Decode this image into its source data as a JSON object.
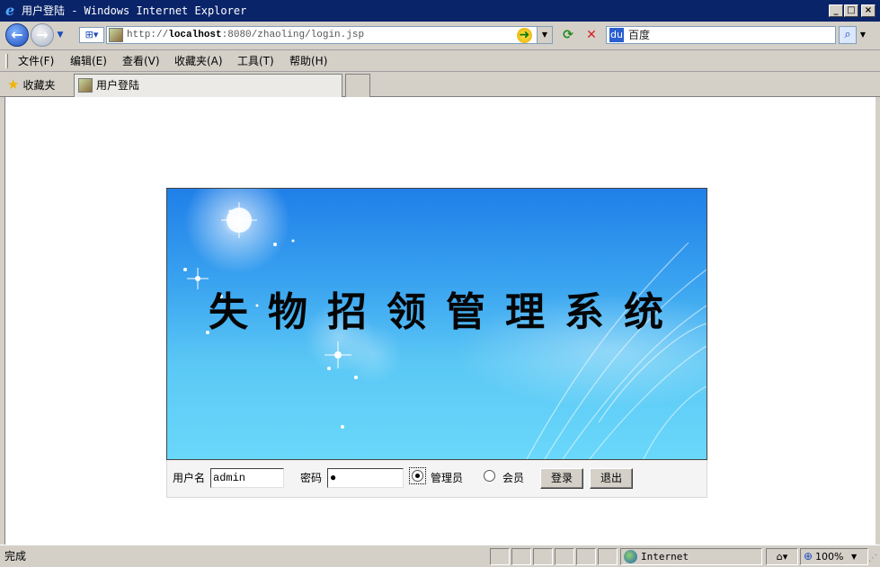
{
  "window": {
    "title": "用户登陆 - Windows Internet Explorer",
    "minimize": "_",
    "maximize": "□",
    "close": "×"
  },
  "address_bar": {
    "url_prefix": "http://",
    "url_host": "localhost",
    "url_rest": ":8080/zhaoling/login.jsp",
    "search_placeholder": "百度"
  },
  "menu": {
    "items": [
      {
        "label": "文件(F)"
      },
      {
        "label": "编辑(E)"
      },
      {
        "label": "查看(V)"
      },
      {
        "label": "收藏夹(A)"
      },
      {
        "label": "工具(T)"
      },
      {
        "label": "帮助(H)"
      }
    ]
  },
  "tabs": {
    "favorites_label": "收藏夹",
    "active_tab_label": "用户登陆"
  },
  "page": {
    "system_title": "失物招领管理系统",
    "login": {
      "username_label": "用户名",
      "username_value": "admin",
      "password_label": "密码",
      "password_value": "●",
      "role_admin_label": "管理员",
      "role_member_label": "会员",
      "selected_role": "管理员",
      "login_button": "登录",
      "exit_button": "退出"
    }
  },
  "status_bar": {
    "status_text": "完成",
    "zone_text": "Internet",
    "zoom_text": "100%"
  }
}
